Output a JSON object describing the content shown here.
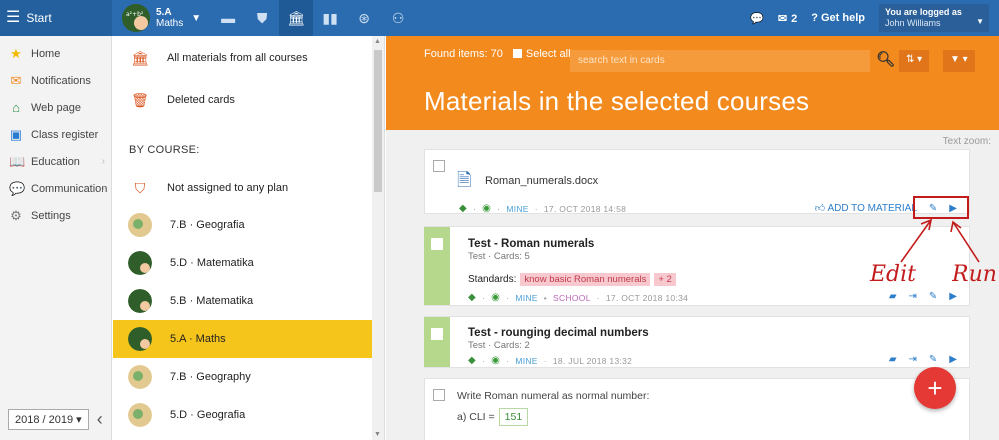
{
  "topbar": {
    "start_label": "Start",
    "class_line1": "5.A",
    "class_line2": "Maths",
    "message_count": "2",
    "help_label": "Get help",
    "user_line1": "You are logged as",
    "user_line2": "John Williams",
    "accent_color": "#2b6cb0"
  },
  "sidebar": {
    "items": [
      {
        "label": "Home",
        "icon": "star-icon"
      },
      {
        "label": "Notifications",
        "icon": "envelope-icon"
      },
      {
        "label": "Web page",
        "icon": "house-icon"
      },
      {
        "label": "Class register",
        "icon": "register-icon"
      },
      {
        "label": "Education",
        "icon": "book-icon"
      },
      {
        "label": "Communication",
        "icon": "chat-icon"
      },
      {
        "label": "Settings",
        "icon": "gear-icon"
      }
    ],
    "year": "2018 / 2019"
  },
  "course_list": {
    "all_materials": "All materials from all courses",
    "deleted_cards": "Deleted cards",
    "by_course": "BY COURSE:",
    "not_assigned": "Not assigned to any plan",
    "courses": [
      {
        "label": "7.B · Geografia"
      },
      {
        "label": "5.D · Matematika"
      },
      {
        "label": "5.B · Matematika"
      },
      {
        "label": "5.A · Maths"
      },
      {
        "label": "7.B · Geography"
      },
      {
        "label": "5.D · Geografia"
      }
    ]
  },
  "main": {
    "found_items": "Found items: 70",
    "select_all": "Select all",
    "search_placeholder": "search text in cards",
    "title": "Materials in the selected courses",
    "text_zoom": "Text zoom:",
    "hero_color": "#f28a1e",
    "cards": [
      {
        "file": "Roman_numerals.docx",
        "meta_mine": "MINE",
        "meta_date": "17. OCT 2018 14:58",
        "add_to_material": "ADD TO MATERIAL"
      },
      {
        "title": "Test - Roman numerals",
        "sub": "Test · Cards: 5",
        "standards_label": "Standards:",
        "standard": "know basic Roman numerals",
        "more": "+ 2",
        "meta_mine": "MINE",
        "meta_school": "SCHOOL",
        "meta_date": "17. OCT 2018 10:34"
      },
      {
        "title": "Test - rounging decimal numbers",
        "sub": "Test · Cards: 2",
        "meta_mine": "MINE",
        "meta_date": "18. JUL 2018 13:32"
      },
      {
        "prompt": "Write Roman numeral as normal number:",
        "q_label": "a) CLI =",
        "answer": "151"
      }
    ]
  },
  "annotations": {
    "edit": "Edit",
    "run": "Run"
  }
}
